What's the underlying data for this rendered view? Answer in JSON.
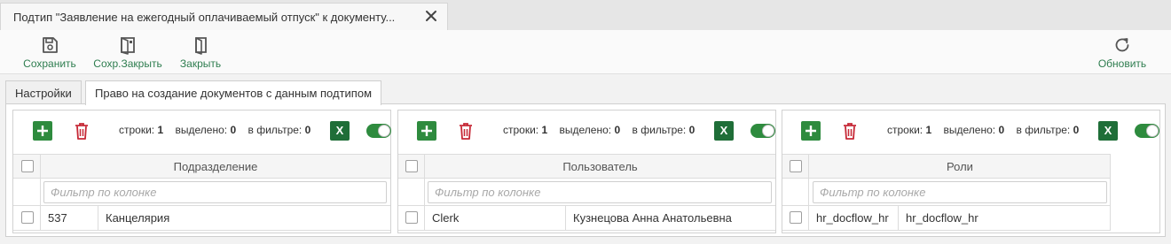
{
  "document_tab": {
    "title": "Подтип \"Заявление на ежегодный оплачиваемый отпуск\" к документу..."
  },
  "toolbar": {
    "save_label": "Сохранить",
    "save_close_label": "Сохр.Закрыть",
    "close_label": "Закрыть",
    "refresh_label": "Обновить"
  },
  "tabs": [
    {
      "label": "Настройки",
      "active": false
    },
    {
      "label": "Право на создание документов с данным подтипом",
      "active": true
    }
  ],
  "stats_labels": {
    "rows": "строки:",
    "selected": "выделено:",
    "filtered": "в фильтре:"
  },
  "excel_label": "X",
  "filter_placeholder": "Фильтр по колонке",
  "panels": [
    {
      "rows": "1",
      "selected": "0",
      "filtered": "0",
      "column": "Подразделение",
      "row": [
        "537",
        "Канцелярия"
      ]
    },
    {
      "rows": "1",
      "selected": "0",
      "filtered": "0",
      "column": "Пользователь",
      "row": [
        "Clerk",
        "Кузнецова Анна Анатольевна"
      ]
    },
    {
      "rows": "1",
      "selected": "0",
      "filtered": "0",
      "column": "Роли",
      "row": [
        "hr_docflow_hr",
        "hr_docflow_hr"
      ]
    }
  ],
  "colors": {
    "accent_green": "#2e8b3e",
    "delete_red": "#c62836",
    "label_green": "#2e7d4f"
  }
}
